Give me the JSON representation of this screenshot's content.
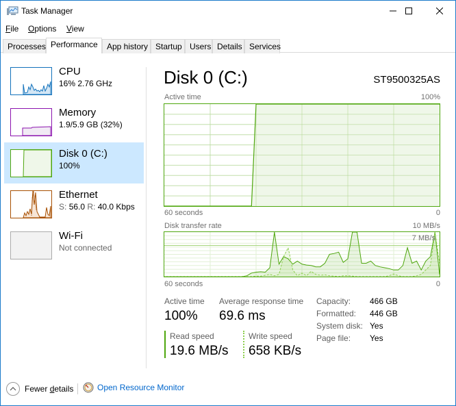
{
  "window": {
    "title": "Task Manager",
    "controls": {
      "minimize": "minimize",
      "maximize": "maximize",
      "close": "close"
    }
  },
  "menu": [
    {
      "label": "File",
      "accel": "F",
      "rest": "ile"
    },
    {
      "label": "Options",
      "accel": "O",
      "rest": "ptions"
    },
    {
      "label": "View",
      "accel": "V",
      "rest": "iew"
    }
  ],
  "tabs": [
    {
      "label": "Processes",
      "active": false
    },
    {
      "label": "Performance",
      "active": true
    },
    {
      "label": "App history",
      "active": false
    },
    {
      "label": "Startup",
      "active": false
    },
    {
      "label": "Users",
      "active": false
    },
    {
      "label": "Details",
      "active": false
    },
    {
      "label": "Services",
      "active": false
    }
  ],
  "sidebar": {
    "items": [
      {
        "name": "CPU",
        "sub": "16%  2.76 GHz",
        "color": "#1171bb",
        "selected": false
      },
      {
        "name": "Memory",
        "sub": "1.9/5.9 GB (32%)",
        "color": "#8b12ae",
        "selected": false
      },
      {
        "name": "Disk 0 (C:)",
        "sub": "100%",
        "color": "#4da60c",
        "selected": true
      },
      {
        "name": "Ethernet",
        "sub_s_label": "S:",
        "sub_s_val": "56.0",
        "sub_r_label": "R:",
        "sub_r_val": "40.0 Kbps",
        "color": "#a74f01",
        "selected": false
      },
      {
        "name": "Wi-Fi",
        "sub": "Not connected",
        "color": "#aaaaaa",
        "selected": false
      }
    ]
  },
  "main": {
    "title": "Disk 0 (C:)",
    "model": "ST9500325AS",
    "active_graph": {
      "label": "Active time",
      "max_label": "100%",
      "left_axis": "60 seconds",
      "right_axis": "0"
    },
    "transfer_graph": {
      "label": "Disk transfer rate",
      "max_label": "10 MB/s",
      "marker_label": "7 MB/s",
      "left_axis": "60 seconds",
      "right_axis": "0"
    },
    "stats": {
      "active_time_label": "Active time",
      "active_time_value": "100%",
      "avg_response_label": "Average response time",
      "avg_response_value": "69.6 ms",
      "read_label": "Read speed",
      "read_value": "19.6 MB/s",
      "write_label": "Write speed",
      "write_value": "658 KB/s"
    },
    "properties": [
      {
        "key": "Capacity:",
        "value": "466 GB"
      },
      {
        "key": "Formatted:",
        "value": "446 GB"
      },
      {
        "key": "System disk:",
        "value": "Yes"
      },
      {
        "key": "Page file:",
        "value": "Yes"
      }
    ]
  },
  "footer": {
    "fewer_details": "Fewer details",
    "fewer_accel_pre": "Fewer ",
    "fewer_accel": "d",
    "fewer_accel_post": "etails",
    "resource_monitor": "Open Resource Monitor"
  },
  "chart_data": [
    {
      "type": "area",
      "title": "Active time",
      "xlabel": "60 seconds",
      "ylabel": "",
      "xlim": [
        60,
        0
      ],
      "ylim": [
        0,
        100
      ],
      "y_unit": "%",
      "series": [
        {
          "name": "Active time",
          "x": [
            60,
            59,
            58,
            57,
            56,
            55,
            54,
            53,
            52,
            51,
            50,
            49,
            48,
            47,
            46,
            45,
            44,
            43,
            42,
            41,
            40,
            39,
            38,
            37,
            36,
            35,
            34,
            33,
            32,
            31,
            30,
            29,
            28,
            27,
            26,
            25,
            24,
            23,
            22,
            21,
            20,
            19,
            18,
            17,
            16,
            15,
            14,
            13,
            12,
            11,
            10,
            9,
            8,
            7,
            6,
            5,
            4,
            3,
            2,
            1,
            0
          ],
          "values": [
            0,
            0,
            0,
            0,
            0,
            0,
            0,
            0,
            0,
            0,
            0,
            0,
            0,
            0,
            0,
            0,
            0,
            0,
            0,
            0,
            100,
            100,
            100,
            100,
            100,
            100,
            100,
            100,
            100,
            100,
            100,
            100,
            100,
            100,
            100,
            100,
            100,
            100,
            100,
            100,
            100,
            100,
            100,
            100,
            100,
            100,
            100,
            100,
            100,
            100,
            100,
            100,
            100,
            100,
            100,
            100,
            100,
            100,
            100,
            100,
            100
          ]
        }
      ]
    },
    {
      "type": "line",
      "title": "Disk transfer rate",
      "xlabel": "60 seconds",
      "ylabel": "",
      "xlim": [
        60,
        0
      ],
      "ylim": [
        0,
        10
      ],
      "y_unit": "MB/s",
      "marker_line": 7,
      "series": [
        {
          "name": "Read speed",
          "style": "solid",
          "values": [
            0,
            0,
            0,
            0,
            0,
            0,
            0,
            0,
            0,
            0,
            0,
            0,
            0,
            0,
            0,
            0,
            0,
            0,
            0.2,
            0.8,
            1.0,
            1.1,
            1.0,
            2.0,
            10.0,
            2.8,
            4.5,
            4.0,
            2.8,
            3.5,
            2.8,
            2.6,
            2.5,
            2.2,
            2.2,
            3.0,
            5.0,
            5.2,
            5.5,
            3.2,
            4.0,
            10.0,
            10.0,
            3.0,
            3.0,
            3.5,
            2.5,
            2.2,
            2.0,
            1.8,
            1.5,
            1.5,
            2.5,
            6.5,
            3.0,
            3.5,
            1.5,
            3.5,
            4.5,
            10.0,
            0.5
          ]
        },
        {
          "name": "Write speed",
          "style": "dashed",
          "values": [
            0,
            0,
            0,
            0,
            0,
            0,
            0,
            0,
            0,
            0,
            0,
            0,
            0,
            0,
            0,
            0,
            0,
            0,
            0,
            0,
            0.1,
            0.1,
            0.3,
            0.5,
            0.2,
            0.5,
            4.5,
            6.5,
            1.5,
            0.2,
            0.8,
            0.2,
            1.2,
            0.5,
            0.3,
            0.4,
            0.2,
            0.1,
            0,
            0.2,
            0.2,
            0.1,
            0,
            0,
            0,
            0,
            0,
            0,
            0,
            0.2,
            0.6,
            0.2,
            0,
            0,
            0,
            0.2,
            0.5,
            1.5,
            2.5,
            10.0,
            3.0
          ]
        }
      ]
    }
  ]
}
